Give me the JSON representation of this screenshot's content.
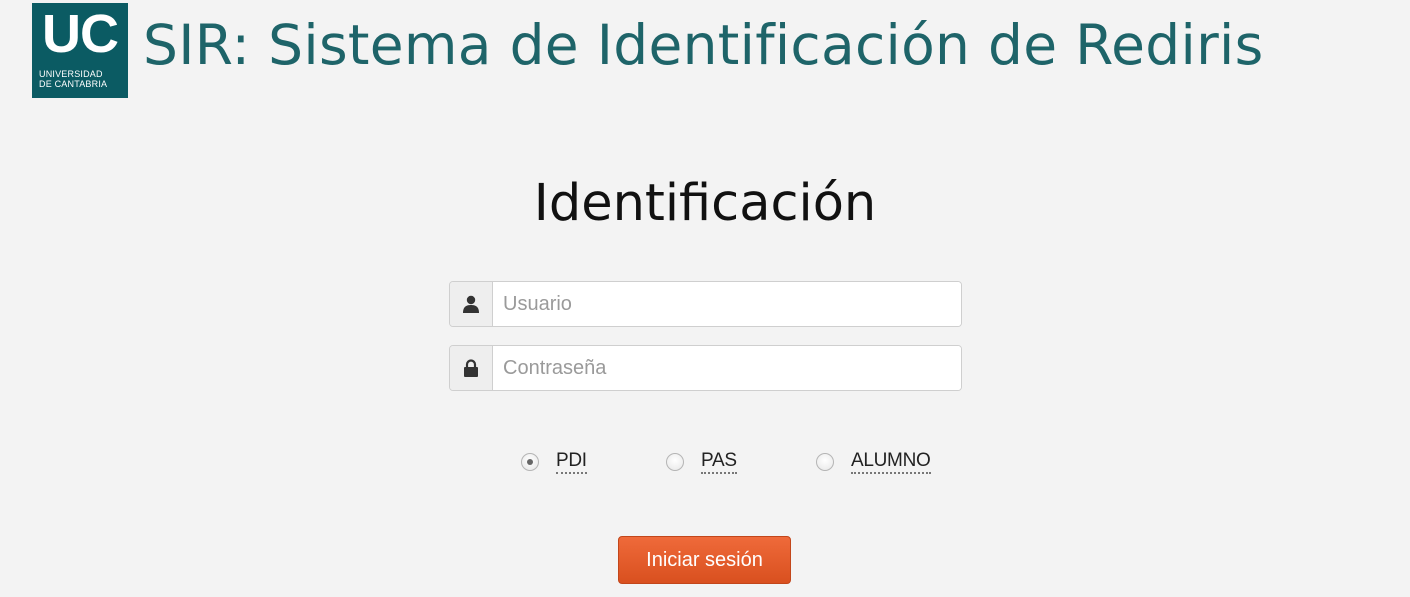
{
  "header": {
    "logo": {
      "mark": "UC",
      "line1": "UNIVERSIDAD",
      "line2": "DE CANTABRIA"
    },
    "title": "SIR: Sistema de Identificación de Rediris"
  },
  "form": {
    "title": "Identificación",
    "username": {
      "placeholder": "Usuario",
      "value": "",
      "icon": "user-icon"
    },
    "password": {
      "placeholder": "Contraseña",
      "value": "",
      "icon": "lock-icon"
    },
    "roles": [
      {
        "label": "PDI",
        "checked": true
      },
      {
        "label": "PAS",
        "checked": false
      },
      {
        "label": "ALUMNO",
        "checked": false
      }
    ],
    "submit_label": "Iniciar sesión"
  },
  "colors": {
    "background": "#f3f3f3",
    "brand": "#0b5b63",
    "title_text": "#1e6469",
    "button": "#e35b2a"
  }
}
